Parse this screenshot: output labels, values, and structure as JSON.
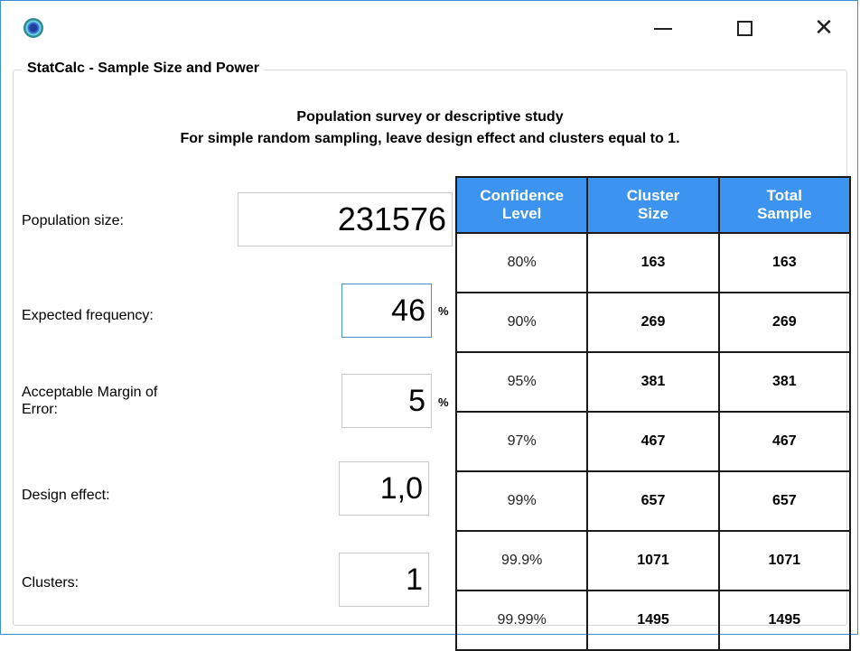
{
  "window": {
    "minimize_icon": "minimize-icon",
    "maximize_icon": "maximize-icon",
    "close_glyph": "✕"
  },
  "group_title": "StatCalc - Sample Size and Power",
  "header": {
    "line1": "Population survey or descriptive study",
    "line2": "For simple random sampling, leave design effect and clusters equal to 1."
  },
  "inputs": {
    "population_size": {
      "label": "Population size:",
      "value": "231576"
    },
    "expected_frequency": {
      "label": "Expected frequency:",
      "value": "46",
      "unit": "%"
    },
    "margin_of_error": {
      "label_line1": "Acceptable Margin of",
      "label_line2": "Error:",
      "value": "5",
      "unit": "%"
    },
    "design_effect": {
      "label": "Design effect:",
      "value": "1,0"
    },
    "clusters": {
      "label": "Clusters:",
      "value": "1"
    }
  },
  "table": {
    "headers": [
      {
        "line1": "Confidence",
        "line2": "Level"
      },
      {
        "line1": "Cluster",
        "line2": "Size"
      },
      {
        "line1": "Total",
        "line2": "Sample"
      }
    ],
    "rows": [
      {
        "confidence": "80%",
        "cluster_size": "163",
        "total_sample": "163"
      },
      {
        "confidence": "90%",
        "cluster_size": "269",
        "total_sample": "269"
      },
      {
        "confidence": "95%",
        "cluster_size": "381",
        "total_sample": "381"
      },
      {
        "confidence": "97%",
        "cluster_size": "467",
        "total_sample": "467"
      },
      {
        "confidence": "99%",
        "cluster_size": "657",
        "total_sample": "657"
      },
      {
        "confidence": "99.9%",
        "cluster_size": "1071",
        "total_sample": "1071"
      },
      {
        "confidence": "99.99%",
        "cluster_size": "1495",
        "total_sample": "1495"
      }
    ]
  },
  "colors": {
    "header_bg": "#3d94f0",
    "window_border": "#3c8fd6"
  }
}
